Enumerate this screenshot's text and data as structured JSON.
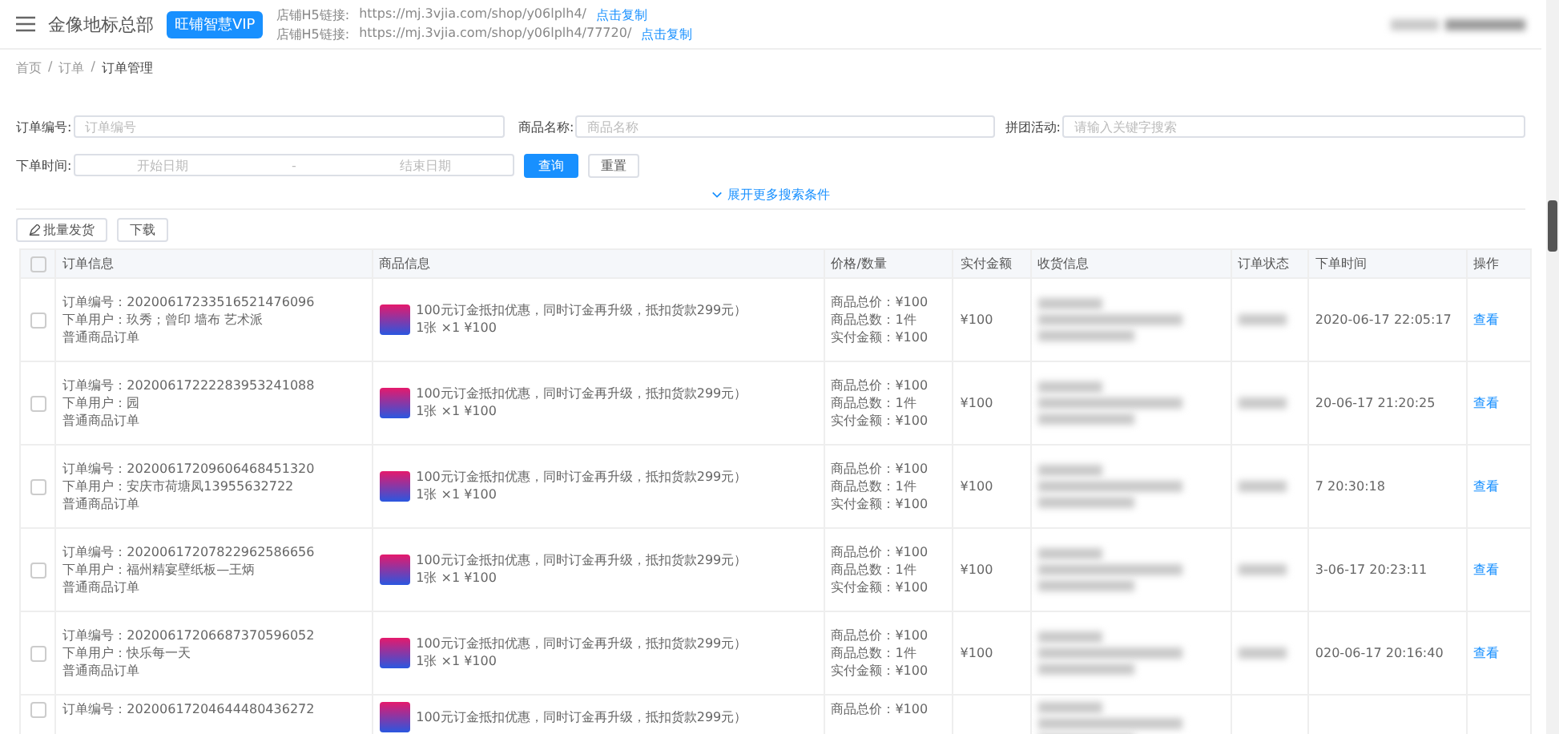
{
  "header": {
    "store_name": "金像地标总部",
    "vip_badge": "旺铺智慧VIP",
    "links": [
      {
        "label": "店铺H5链接:",
        "url": "https://mj.3vjia.com/shop/y06lplh4/",
        "action": "点击复制"
      },
      {
        "label": "店铺H5链接:",
        "url": "https://mj.3vjia.com/shop/y06lplh4/77720/",
        "action": "点击复制"
      }
    ]
  },
  "breadcrumb_separator": "/",
  "select_all_checked": false,
  "breadcrumb": [
    {
      "label": "首页",
      "selected": false
    },
    {
      "label": "订单",
      "selected": false
    },
    {
      "label": "订单管理",
      "selected": true
    }
  ],
  "filters": {
    "order_no": {
      "label": "订单编号:",
      "placeholder": "订单编号"
    },
    "product_name": {
      "label": "商品名称:",
      "placeholder": "商品名称"
    },
    "group_activity": {
      "label": "拼团活动:",
      "placeholder": "请输入关键字搜索"
    },
    "order_time": {
      "label": "下单时间:",
      "start_placeholder": "开始日期",
      "separator": "-",
      "end_placeholder": "结束日期"
    },
    "search_button": "查询",
    "reset_button": "重置",
    "expand_link": "展开更多搜索条件"
  },
  "actions": {
    "batch_ship": "批量发货",
    "download": "下载"
  },
  "table": {
    "columns": [
      "订单信息",
      "商品信息",
      "价格/数量",
      "实付金额",
      "收货信息",
      "订单状态",
      "下单时间",
      "操作"
    ],
    "rows": [
      {
        "checked": false,
        "order_info": [
          "订单编号：20200617233516521476096",
          "下单用户：玖秀；曾印 墙布 艺术派",
          "普通商品订单"
        ],
        "product": [
          "100元订金抵扣优惠，同时订金再升级，抵扣货款299元）",
          "1张 ×1  ¥100"
        ],
        "price_qty": [
          "商品总价：¥100",
          "商品总数：1件",
          "实付金额：¥100"
        ],
        "paid": "¥100",
        "order_time": "2020-06-17 22:05:17",
        "action": "查看"
      },
      {
        "checked": false,
        "order_info": [
          "订单编号：20200617222283953241088",
          "下单用户：园",
          "普通商品订单"
        ],
        "product": [
          "100元订金抵扣优惠，同时订金再升级，抵扣货款299元）",
          "1张 ×1  ¥100"
        ],
        "price_qty": [
          "商品总价：¥100",
          "商品总数：1件",
          "实付金额：¥100"
        ],
        "paid": "¥100",
        "order_time": "20-06-17 21:20:25",
        "action": "查看"
      },
      {
        "checked": false,
        "order_info": [
          "订单编号：20200617209606468451320",
          "下单用户：安庆市荷塘凤13955632722",
          "普通商品订单"
        ],
        "product": [
          "100元订金抵扣优惠，同时订金再升级，抵扣货款299元）",
          "1张 ×1  ¥100"
        ],
        "price_qty": [
          "商品总价：¥100",
          "商品总数：1件",
          "实付金额：¥100"
        ],
        "paid": "¥100",
        "order_time": "7 20:30:18",
        "action": "查看"
      },
      {
        "checked": false,
        "order_info": [
          "订单编号：20200617207822962586656",
          "下单用户：福州精宴壁纸板—王炳",
          "普通商品订单"
        ],
        "product": [
          "100元订金抵扣优惠，同时订金再升级，抵扣货款299元）",
          "1张 ×1  ¥100"
        ],
        "price_qty": [
          "商品总价：¥100",
          "商品总数：1件",
          "实付金额：¥100"
        ],
        "paid": "¥100",
        "order_time": "3-06-17 20:23:11",
        "action": "查看"
      },
      {
        "checked": false,
        "order_info": [
          "订单编号：20200617206687370596052",
          "下单用户：快乐每一天",
          "普通商品订单"
        ],
        "product": [
          "100元订金抵扣优惠，同时订金再升级，抵扣货款299元）",
          "1张 ×1  ¥100"
        ],
        "price_qty": [
          "商品总价：¥100",
          "商品总数：1件",
          "实付金额：¥100"
        ],
        "paid": "¥100",
        "order_time": "020-06-17 20:16:40",
        "action": "查看"
      },
      {
        "checked": false,
        "order_info": [
          "订单编号：20200617204644480436272"
        ],
        "product": [
          "100元订金抵扣优惠，同时订金再升级，抵扣货款299元）"
        ],
        "price_qty": [
          "商品总价：¥100"
        ]
      }
    ]
  }
}
